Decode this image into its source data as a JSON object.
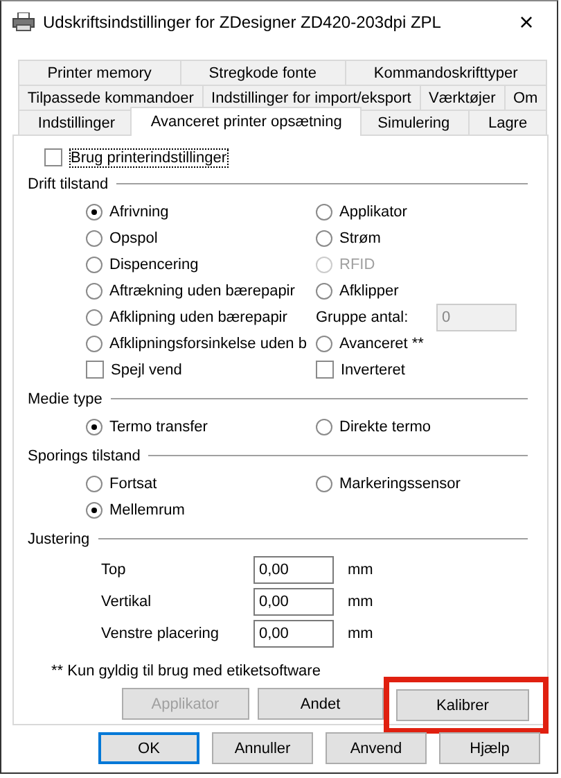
{
  "window": {
    "title": "Udskriftsindstillinger for ZDesigner ZD420-203dpi ZPL",
    "close": "×"
  },
  "tab_rows": [
    [
      {
        "label": "Printer memory",
        "selected": false
      },
      {
        "label": "Stregkode fonte",
        "selected": false
      },
      {
        "label": "Kommandoskrifttyper",
        "selected": false
      }
    ],
    [
      {
        "label": "Tilpassede kommandoer",
        "selected": false
      },
      {
        "label": "Indstillinger for import/eksport",
        "selected": false
      },
      {
        "label": "Værktøjer",
        "selected": false
      },
      {
        "label": "Om",
        "selected": false
      }
    ],
    [
      {
        "label": "Indstillinger",
        "selected": false
      },
      {
        "label": "Avanceret printer opsætning",
        "selected": true
      },
      {
        "label": "Simulering",
        "selected": false
      },
      {
        "label": "Lagre",
        "selected": false
      }
    ]
  ],
  "use_printer_settings": {
    "label": "Brug printerindstillinger",
    "checked": false
  },
  "groups": [
    {
      "title": "Drift tilstand",
      "items": [
        {
          "kind": "radio",
          "label": "Afrivning",
          "selected": true,
          "disabled": false
        },
        {
          "kind": "radio",
          "label": "Applikator",
          "selected": false,
          "disabled": false
        },
        {
          "kind": "radio",
          "label": "Opspol",
          "selected": false,
          "disabled": false
        },
        {
          "kind": "radio",
          "label": "Strøm",
          "selected": false,
          "disabled": false
        },
        {
          "kind": "radio",
          "label": "Dispencering",
          "selected": false,
          "disabled": false
        },
        {
          "kind": "radio",
          "label": "RFID",
          "selected": false,
          "disabled": true
        },
        {
          "kind": "radio",
          "label": "Aftrækning uden bærepapir",
          "selected": false,
          "disabled": false
        },
        {
          "kind": "radio",
          "label": "Afklipper",
          "selected": false,
          "disabled": false
        },
        {
          "kind": "radio",
          "label": "Afklipning uden bærepapir",
          "selected": false,
          "disabled": false
        },
        {
          "kind": "field",
          "label": "Gruppe antal:",
          "value": "0",
          "disabled": true
        },
        {
          "kind": "radio",
          "label": "Afklipningsforsinkelse uden b",
          "selected": false,
          "disabled": false
        },
        {
          "kind": "radio",
          "label": "Avanceret **",
          "selected": false,
          "disabled": false
        },
        {
          "kind": "checkbox",
          "label": "Spejl vend",
          "checked": false,
          "disabled": false
        },
        {
          "kind": "checkbox",
          "label": "Inverteret",
          "checked": false,
          "disabled": false
        }
      ]
    },
    {
      "title": "Medie type",
      "items": [
        {
          "kind": "radio",
          "label": "Termo transfer",
          "selected": true,
          "disabled": false
        },
        {
          "kind": "radio",
          "label": "Direkte termo",
          "selected": false,
          "disabled": false
        }
      ]
    },
    {
      "title": "Sporings tilstand",
      "items": [
        {
          "kind": "radio",
          "label": "Fortsat",
          "selected": false,
          "disabled": false
        },
        {
          "kind": "radio",
          "label": "Markeringssensor",
          "selected": false,
          "disabled": false
        },
        {
          "kind": "radio",
          "label": "Mellemrum",
          "selected": true,
          "disabled": false
        }
      ]
    }
  ],
  "adjustment": {
    "title": "Justering",
    "rows": [
      {
        "label": "Top",
        "value": "0,00",
        "unit": "mm"
      },
      {
        "label": "Vertikal",
        "value": "0,00",
        "unit": "mm"
      },
      {
        "label": "Venstre placering",
        "value": "0,00",
        "unit": "mm"
      }
    ]
  },
  "footnote": "** Kun gyldig til brug med etiketsoftware",
  "panel_buttons": [
    {
      "label": "Applikator",
      "disabled": true,
      "highlighted": false
    },
    {
      "label": "Andet",
      "disabled": false,
      "highlighted": false
    },
    {
      "label": "Kalibrer",
      "disabled": false,
      "highlighted": true
    }
  ],
  "dialog_buttons": [
    {
      "label": "OK",
      "default": true
    },
    {
      "label": "Annuller",
      "default": false
    },
    {
      "label": "Anvend",
      "default": false
    },
    {
      "label": "Hjælp",
      "default": false
    }
  ]
}
